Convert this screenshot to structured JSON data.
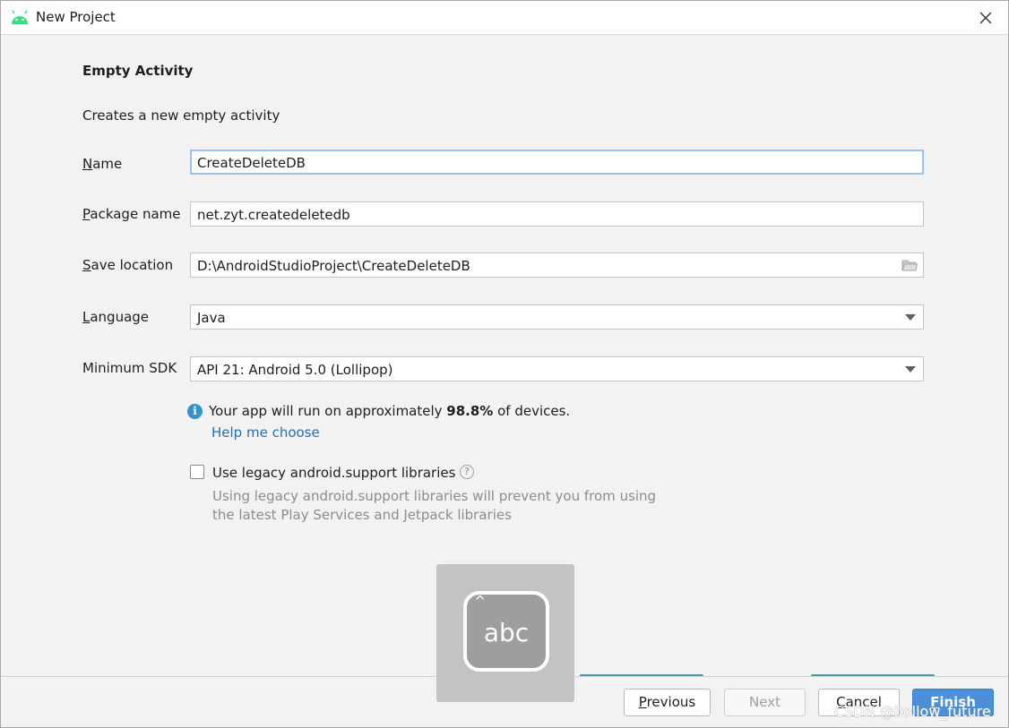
{
  "window": {
    "title": "New Project",
    "close_icon": "close-icon",
    "app_icon": "android-icon",
    "accent": "#3ddc84"
  },
  "section": {
    "title": "Empty Activity",
    "description": "Creates a new empty activity"
  },
  "form": {
    "name": {
      "label_mnemonic": "N",
      "label_rest": "ame",
      "value": "CreateDeleteDB"
    },
    "package": {
      "label_mnemonic": "P",
      "label_rest": "ackage name",
      "value": "net.zyt.createdeletedb"
    },
    "location": {
      "label_mnemonic": "S",
      "label_rest": "ave location",
      "value": "D:\\AndroidStudioProject\\CreateDeleteDB",
      "icon": "folder-icon"
    },
    "language": {
      "label_mnemonic": "L",
      "label_rest": "anguage",
      "value": "Java"
    },
    "min_sdk": {
      "label": "Minimum SDK",
      "value": "API 21: Android 5.0 (Lollipop)"
    }
  },
  "info": {
    "prefix": "Your app will run on approximately ",
    "percent": "98.8%",
    "suffix": " of devices.",
    "link": "Help me choose"
  },
  "legacy": {
    "checked": false,
    "label": "Use legacy android.support libraries",
    "hint_line1": "Using legacy android.support libraries will prevent you from using",
    "hint_line2": "the latest Play Services and Jetpack libraries"
  },
  "buttons": {
    "previous_mnemonic": "P",
    "previous_rest": "revious",
    "next": "Next",
    "cancel_mnemonic": "C",
    "cancel_rest": "ancel",
    "finish_mnemonic": "F",
    "finish_rest": "inish"
  },
  "overlay": {
    "text": "abc",
    "icon": "keyboard-icon"
  },
  "watermark": "CSDN @hollow_future"
}
